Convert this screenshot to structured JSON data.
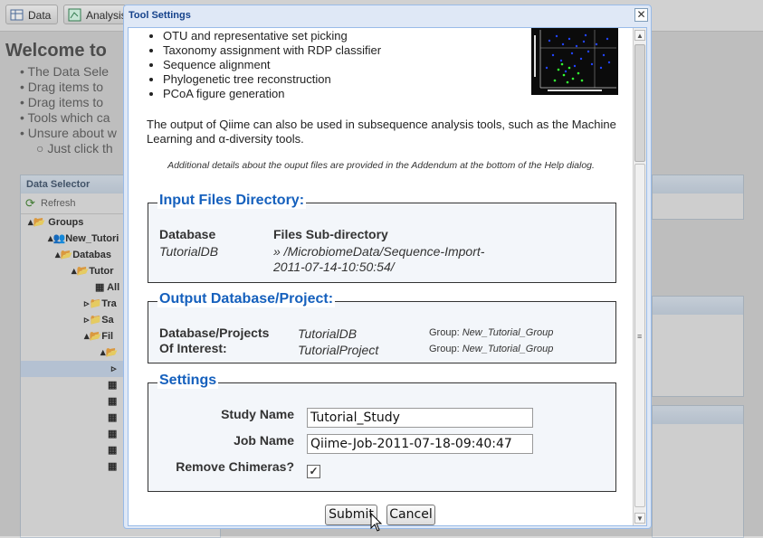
{
  "toolbar": {
    "data_label": "Data",
    "analysis_label": "Analysis"
  },
  "welcome": {
    "title": "Welcome to",
    "bullets": [
      "The Data Sele",
      "Drag items to",
      "Drag items to",
      "Tools which ca",
      "Unsure about w"
    ],
    "sub_bullet": "Just click th"
  },
  "data_selector": {
    "title": "Data Selector",
    "refresh_label": "Refresh",
    "tree": [
      "Groups",
      "New_Tutori",
      "Databas",
      "Tutor",
      "All",
      "Tra",
      "Sa",
      "Fil"
    ]
  },
  "dialog": {
    "title": "Tool Settings",
    "features": [
      "OTU and representative set picking",
      "Taxonomy assignment with RDP classifier",
      "Sequence alignment",
      "Phylogenetic tree reconstruction",
      "PCoA figure generation"
    ],
    "paragraph": "The output of Qiime can also be used in subsequence analysis tools, such as the Machine Learning and α-diversity tools.",
    "note": "Additional details about the ouput files are provided in the Addendum at the bottom of the Help dialog.",
    "input_files": {
      "legend": "Input Files Directory:",
      "col1_header": "Database",
      "col2_header": "Files Sub-directory",
      "database": "TutorialDB",
      "subdir_line1": "» /MicrobiomeData/Sequence-Import-",
      "subdir_line2": "2011-07-14-10:50:54/"
    },
    "output_db": {
      "legend": "Output Database/Project:",
      "label_line1": "Database/Projects",
      "label_line2": "Of Interest:",
      "database": "TutorialDB",
      "project": "TutorialProject",
      "group_prefix": "Group:",
      "db_group": "New_Tutorial_Group",
      "project_group": "New_Tutorial_Group"
    },
    "settings": {
      "legend": "Settings",
      "study_name_label": "Study Name",
      "study_name_value": "Tutorial_Study",
      "job_name_label": "Job Name",
      "job_name_value": "Qiime-Job-2011-07-18-09:40:47",
      "remove_chimeras_label": "Remove Chimeras?",
      "remove_chimeras_checked": true
    },
    "submit_label": "Submit",
    "cancel_label": "Cancel"
  },
  "colors": {
    "legend_blue": "#1560bd",
    "title_blue": "#15428b"
  }
}
